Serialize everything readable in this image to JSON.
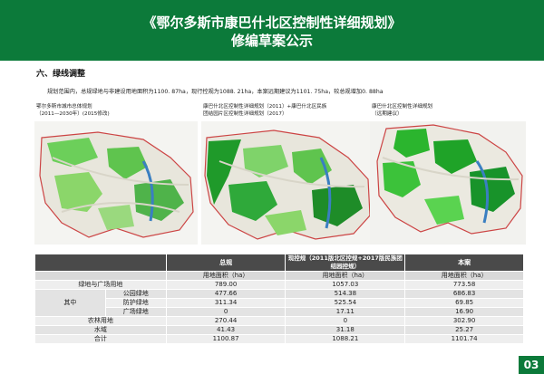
{
  "header": {
    "title_line1": "《鄂尔多斯市康巴什北区控制性详细规划》",
    "title_line2": "修编草案公示"
  },
  "section": {
    "heading": "六、绿线调整",
    "intro": "规划范围内，总规绿地与非建设用地面积为1100. 87ha，现行控规为1088. 21ha，本案远期建议为1101. 75ha，较总规增加0. 88ha"
  },
  "maps": [
    {
      "caption_line1": "鄂尔多斯市城市总体规划",
      "caption_line2": "（2011—2030年）(2015修改)"
    },
    {
      "caption_line1": "康巴什北区控制性详细规划（2011）+康巴什北区民族",
      "caption_line2": "团结园片区控制性详细规划（2017）"
    },
    {
      "caption_line1": "康巴什北区控制性详细规划",
      "caption_line2": "（远期建议）"
    }
  ],
  "table": {
    "header": [
      "总规",
      "现控规（2011版北区控规+2017版民族团结园控规）",
      "本案"
    ],
    "subheader": "用地面积（ha）",
    "rows": [
      {
        "group": "绿地与广场用地",
        "sub": "",
        "values": [
          "789.00",
          "1057.03",
          "773.58"
        ]
      },
      {
        "group": "其中",
        "sub": "公园绿地",
        "values": [
          "477.66",
          "514.38",
          "686.83"
        ]
      },
      {
        "group": "",
        "sub": "防护绿地",
        "values": [
          "311.34",
          "525.54",
          "69.85"
        ]
      },
      {
        "group": "",
        "sub": "广场绿地",
        "values": [
          "0",
          "17.11",
          "16.90"
        ]
      },
      {
        "group": "农林用地",
        "sub": "",
        "values": [
          "270.44",
          "0",
          "302.90"
        ]
      },
      {
        "group": "水域",
        "sub": "",
        "values": [
          "41.43",
          "31.18",
          "25.27"
        ]
      },
      {
        "group": "合计",
        "sub": "",
        "values": [
          "1100.87",
          "1088.21",
          "1101.74"
        ]
      }
    ]
  },
  "page_number": "03",
  "colors": {
    "header_bg": "#0c7a3a",
    "table_header_bg": "#4a4a4a",
    "green_dark": "#1a9a2a",
    "green_light": "#5fd35a"
  }
}
